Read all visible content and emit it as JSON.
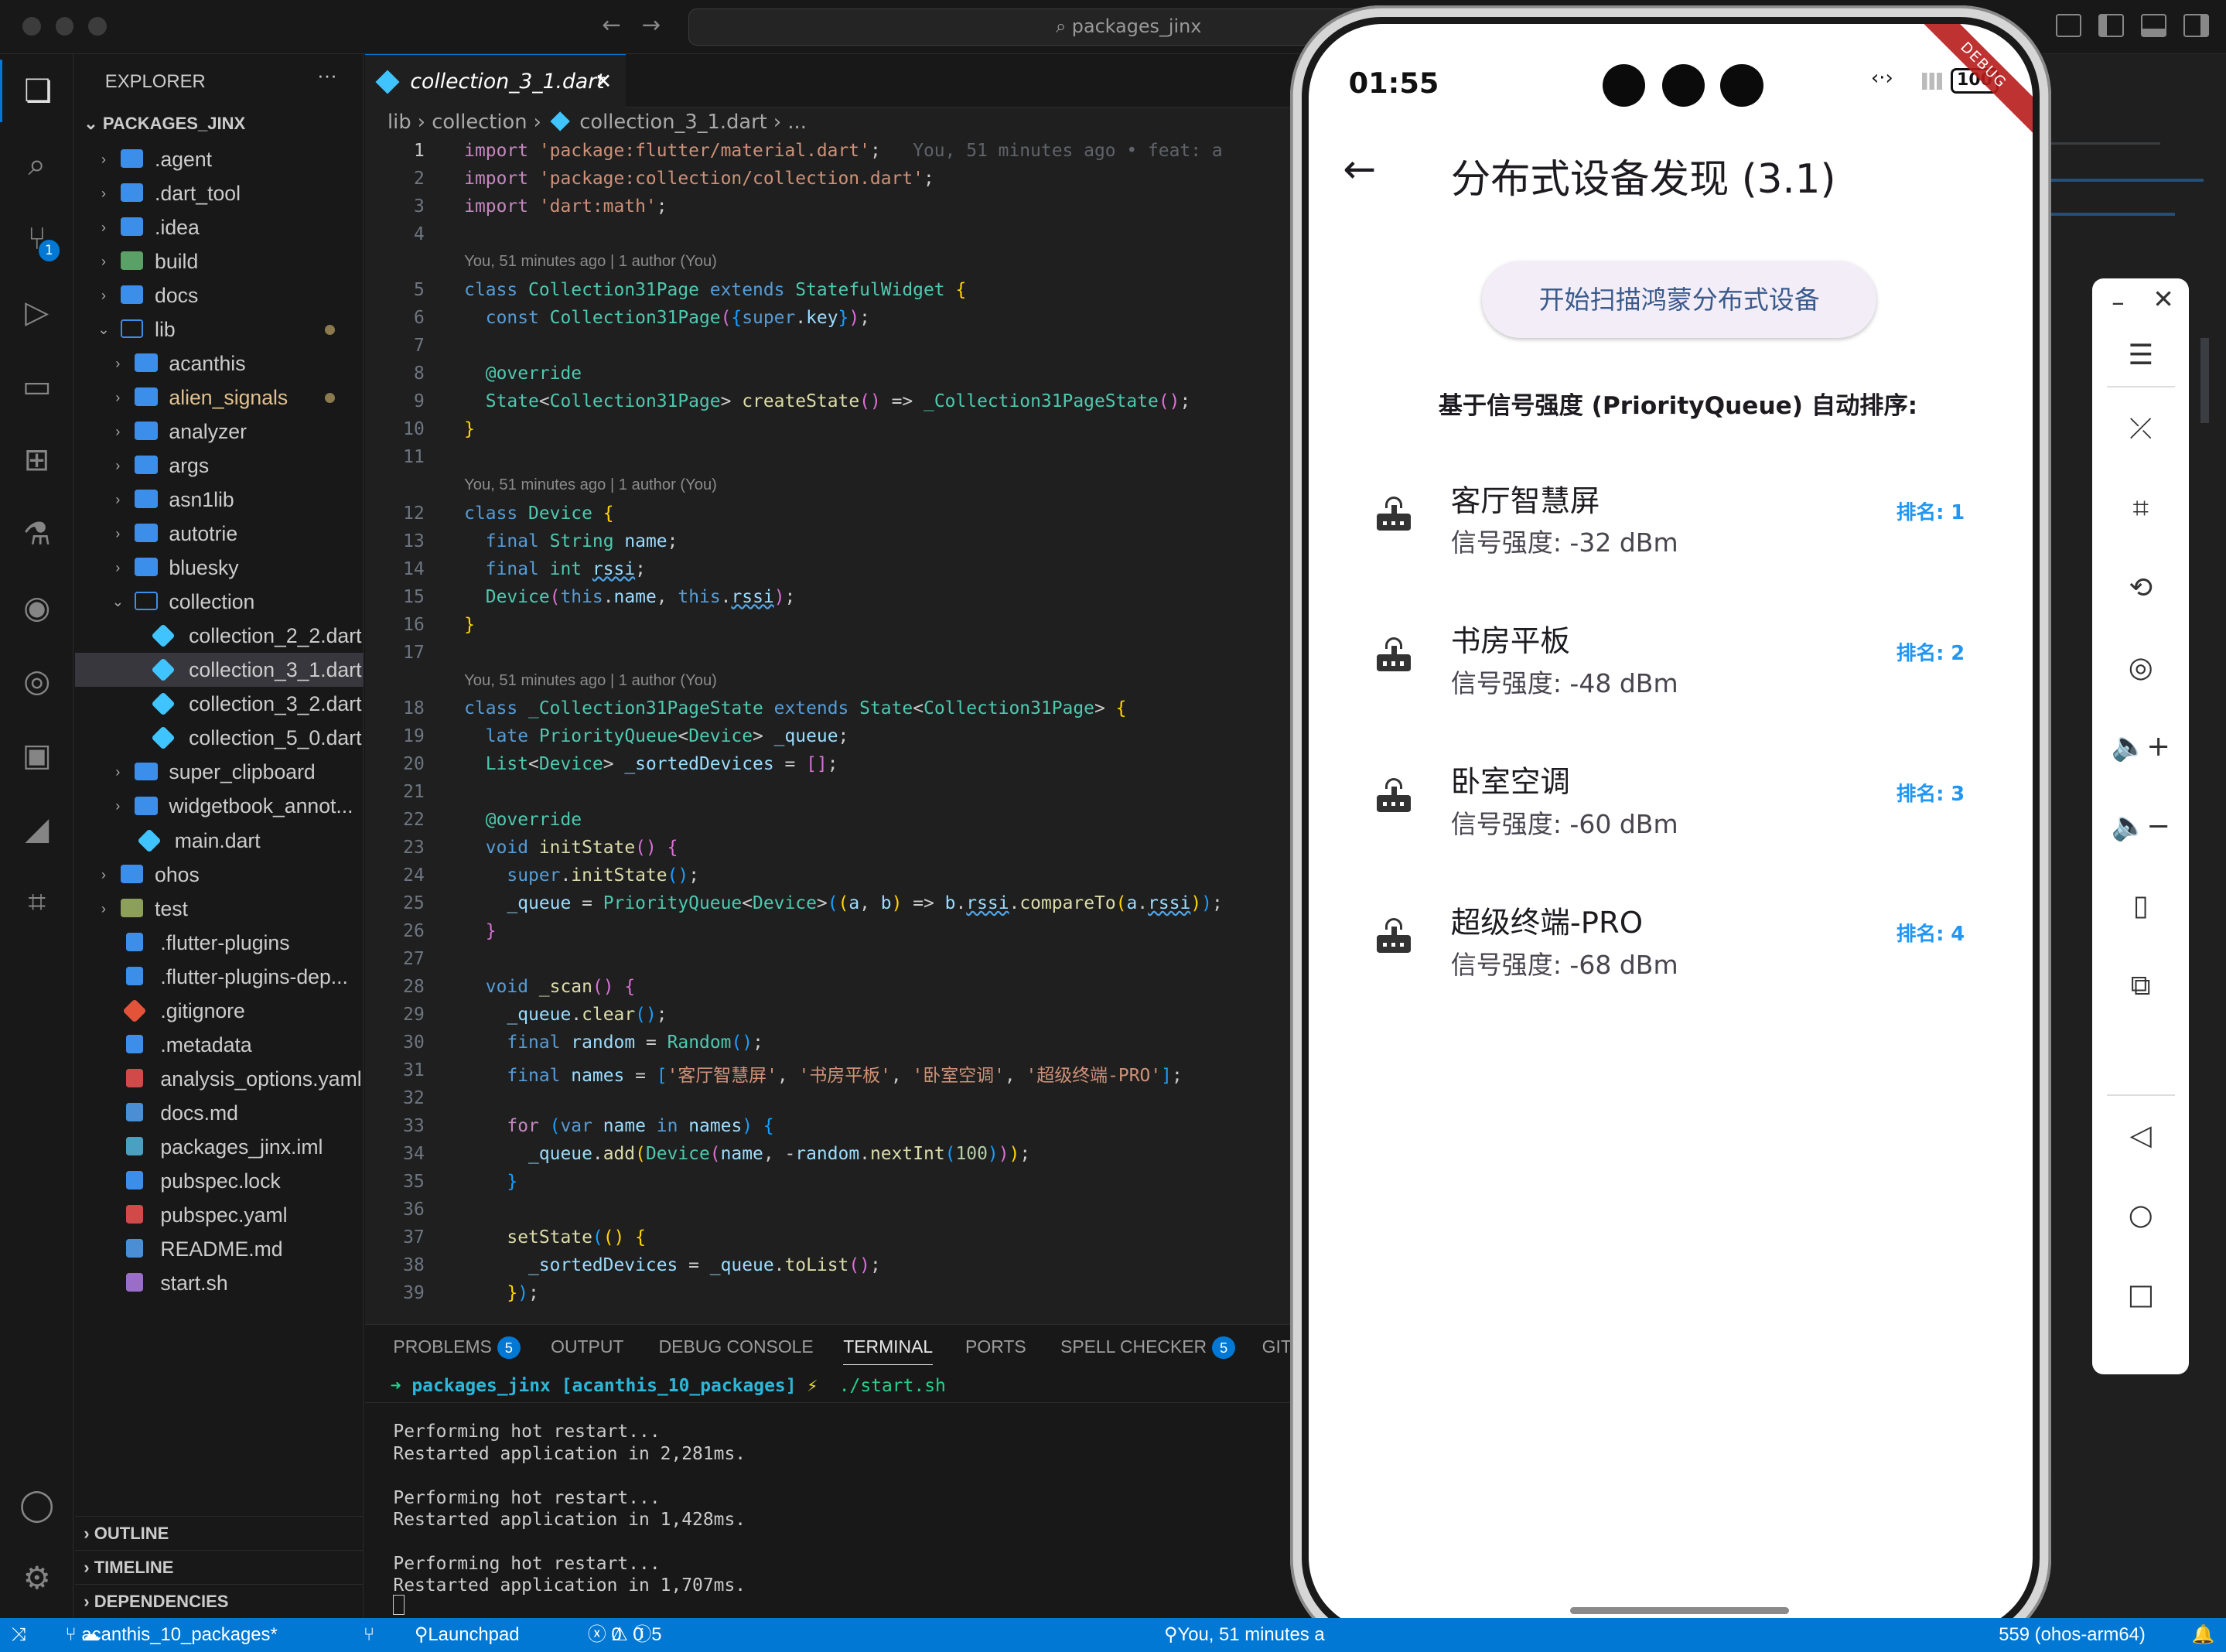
{
  "window": {
    "search": "packages_jinx"
  },
  "activity": {
    "scm_badge": "1"
  },
  "explorer": {
    "title": "EXPLORER",
    "root": "PACKAGES_JINX",
    "items": [
      {
        "label": ".agent",
        "kind": "folder",
        "depth": 0,
        "open": false
      },
      {
        "label": ".dart_tool",
        "kind": "folder",
        "depth": 0,
        "open": false
      },
      {
        "label": ".idea",
        "kind": "folder",
        "depth": 0,
        "open": false
      },
      {
        "label": "build",
        "kind": "folder-build",
        "depth": 0,
        "open": false
      },
      {
        "label": "docs",
        "kind": "folder",
        "depth": 0,
        "open": false
      },
      {
        "label": "lib",
        "kind": "folder",
        "depth": 0,
        "open": true,
        "modified": true
      },
      {
        "label": "acanthis",
        "kind": "folder",
        "depth": 1,
        "open": false
      },
      {
        "label": "alien_signals",
        "kind": "folder",
        "depth": 1,
        "open": false,
        "modified": true
      },
      {
        "label": "analyzer",
        "kind": "folder",
        "depth": 1,
        "open": false
      },
      {
        "label": "args",
        "kind": "folder",
        "depth": 1,
        "open": false
      },
      {
        "label": "asn1lib",
        "kind": "folder",
        "depth": 1,
        "open": false
      },
      {
        "label": "autotrie",
        "kind": "folder",
        "depth": 1,
        "open": false
      },
      {
        "label": "bluesky",
        "kind": "folder",
        "depth": 1,
        "open": false
      },
      {
        "label": "collection",
        "kind": "folder",
        "depth": 1,
        "open": true
      },
      {
        "label": "collection_2_2.dart",
        "kind": "dart",
        "depth": 2
      },
      {
        "label": "collection_3_1.dart",
        "kind": "dart",
        "depth": 2,
        "selected": true
      },
      {
        "label": "collection_3_2.dart",
        "kind": "dart",
        "depth": 2
      },
      {
        "label": "collection_5_0.dart",
        "kind": "dart",
        "depth": 2
      },
      {
        "label": "super_clipboard",
        "kind": "folder",
        "depth": 1,
        "open": false
      },
      {
        "label": "widgetbook_annot...",
        "kind": "folder",
        "depth": 1,
        "open": false
      },
      {
        "label": "main.dart",
        "kind": "dart",
        "depth": 1
      },
      {
        "label": "ohos",
        "kind": "folder",
        "depth": 0,
        "open": false
      },
      {
        "label": "test",
        "kind": "folder-test",
        "depth": 0,
        "open": false
      },
      {
        "label": ".flutter-plugins",
        "kind": "file",
        "depth": 0
      },
      {
        "label": ".flutter-plugins-dep...",
        "kind": "file",
        "depth": 0
      },
      {
        "label": ".gitignore",
        "kind": "git",
        "depth": 0
      },
      {
        "label": ".metadata",
        "kind": "file",
        "depth": 0
      },
      {
        "label": "analysis_options.yaml",
        "kind": "yaml",
        "depth": 0
      },
      {
        "label": "docs.md",
        "kind": "md",
        "depth": 0
      },
      {
        "label": "packages_jinx.iml",
        "kind": "xml",
        "depth": 0
      },
      {
        "label": "pubspec.lock",
        "kind": "file",
        "depth": 0
      },
      {
        "label": "pubspec.yaml",
        "kind": "yaml",
        "depth": 0
      },
      {
        "label": "README.md",
        "kind": "md",
        "depth": 0
      },
      {
        "label": "start.sh",
        "kind": "sh",
        "depth": 0
      }
    ],
    "sections": [
      "OUTLINE",
      "TIMELINE",
      "DEPENDENCIES"
    ]
  },
  "editor": {
    "tab": "collection_3_1.dart",
    "breadcrumb": [
      "lib",
      "collection",
      "collection_3_1.dart",
      "..."
    ],
    "codelens": "You, 51 minutes ago | 1 author (You)",
    "inline_blame": "You, 51 minutes ago • feat: a"
  },
  "panel": {
    "tabs": [
      {
        "label": "PROBLEMS",
        "badge": "5"
      },
      {
        "label": "OUTPUT"
      },
      {
        "label": "DEBUG CONSOLE"
      },
      {
        "label": "TERMINAL",
        "active": true
      },
      {
        "label": "PORTS"
      },
      {
        "label": "SPELL CHECKER",
        "badge": "5"
      },
      {
        "label": "GIT"
      }
    ],
    "prompt_dir": "packages_jinx",
    "prompt_branch": "[acanthis_10_packages]",
    "prompt_symbol": "⚡",
    "command": "./start.sh",
    "output": [
      "Performing hot restart...",
      "Restarted application in 2,281ms.",
      "",
      "Performing hot restart...",
      "Restarted application in 1,428ms.",
      "",
      "Performing hot restart...",
      "Restarted application in 1,707ms."
    ]
  },
  "status": {
    "branch": "acanthis_10_packages*",
    "launchpad": "Launchpad",
    "errors": "0",
    "warnings": "0",
    "info": "5",
    "blame": "You, 51 minutes a",
    "device": "559 (ohos-arm64)"
  },
  "phone": {
    "time": "01:55",
    "battery": "100",
    "debug_banner": "DEBUG",
    "app_title": "分布式设备发现 (3.1)",
    "scan_button": "开始扫描鸿蒙分布式设备",
    "section_title": "基于信号强度 (PriorityQueue) 自动排序:",
    "devices": [
      {
        "name": "客厅智慧屏",
        "signal": "信号强度: -32 dBm",
        "rank": "排名: 1"
      },
      {
        "name": "书房平板",
        "signal": "信号强度: -48 dBm",
        "rank": "排名: 2"
      },
      {
        "name": "卧室空调",
        "signal": "信号强度: -60 dBm",
        "rank": "排名: 3"
      },
      {
        "name": "超级终端-PRO",
        "signal": "信号强度: -68 dBm",
        "rank": "排名: 4"
      }
    ]
  },
  "colors": {
    "accent": "#0078d4",
    "rank": "#2196f3",
    "scan_text": "#3a5a8c"
  }
}
